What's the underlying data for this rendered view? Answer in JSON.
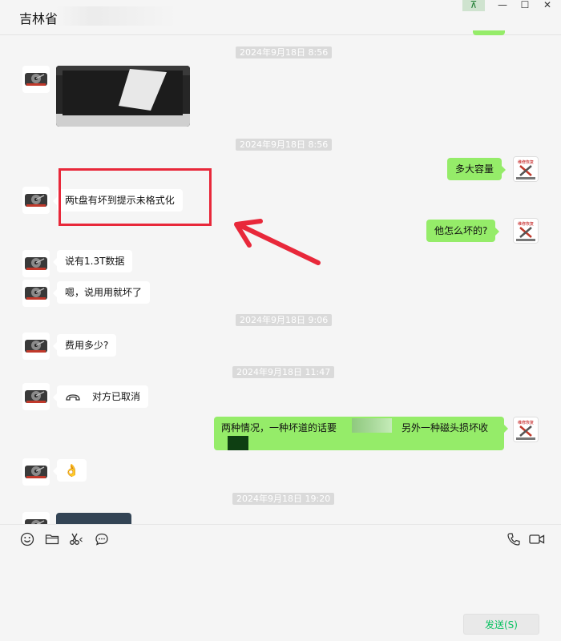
{
  "window": {
    "title": "吉林省",
    "pin_label": "⊼",
    "minimize_label": "—",
    "maximize_label": "☐",
    "close_label": "✕"
  },
  "timestamps": [
    "2024年9月18日 8:56",
    "2024年9月18日 8:56",
    "2024年9月18日 9:06",
    "2024年9月18日 11:47",
    "2024年9月18日 19:20"
  ],
  "messages": {
    "m1": "多大容量",
    "m2": "两t盘有坏到提示未格式化",
    "m3": "他怎么坏的?",
    "m4": "说有1.3T数据",
    "m5": "嗯，说用用就坏了",
    "m6": "费用多少?",
    "m7": "对方已取消",
    "m8_part1": "两种情况，一种坏道的话要",
    "m8_part2": "另外一种磁头损坏收",
    "m9": "👌"
  },
  "composer": {
    "send_label": "发送(S)"
  },
  "colors": {
    "out_bubble": "#95ec69",
    "in_bubble": "#ffffff",
    "annotation": "#e8283a",
    "send_text": "#07c160"
  },
  "icons": [
    "emoji-icon",
    "folder-icon",
    "scissors-icon",
    "chat-history-icon",
    "phone-icon",
    "video-icon",
    "call-cancel-icon",
    "hdd-avatar-icon",
    "repair-logo-icon"
  ]
}
